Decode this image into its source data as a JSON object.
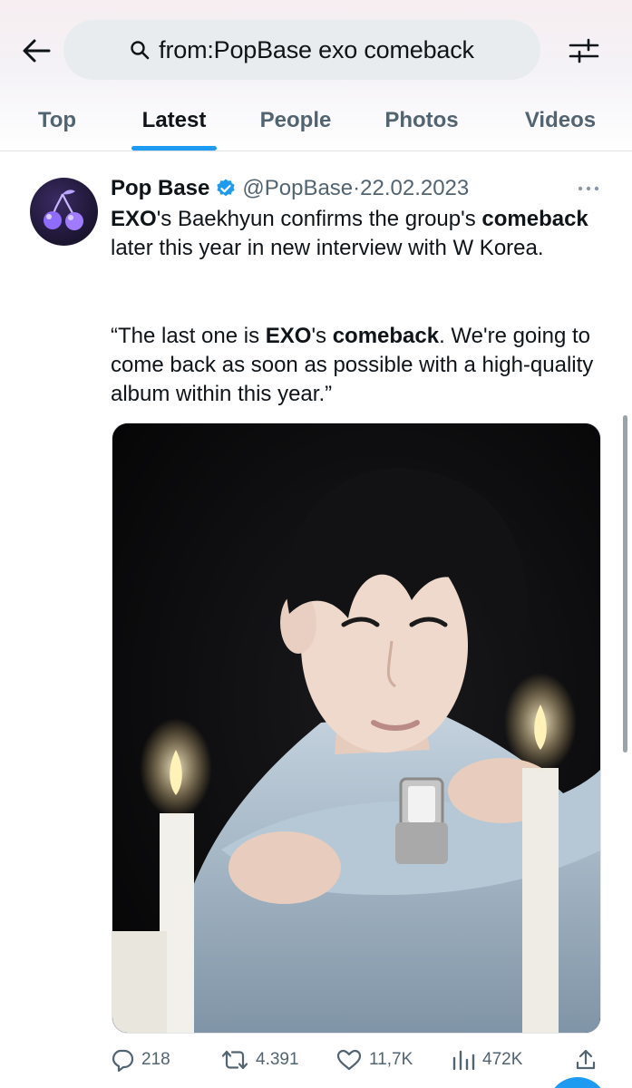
{
  "header": {
    "search_query": "from:PopBase exo comeback",
    "tabs": [
      "Top",
      "Latest",
      "People",
      "Photos",
      "Videos"
    ],
    "active_tab": "Latest"
  },
  "tweet": {
    "display_name": "Pop Base",
    "handle_date": "@PopBase·22.02.2023",
    "para1": [
      {
        "t": "EXO",
        "b": true
      },
      {
        "t": "'s Baekhyun confirms the group's ",
        "b": false
      },
      {
        "t": "comeback",
        "b": true
      },
      {
        "t": " later this year in new interview with W Korea.",
        "b": false
      }
    ],
    "para2": [
      {
        "t": "“The last one is ",
        "b": false
      },
      {
        "t": "EXO",
        "b": true
      },
      {
        "t": "'s ",
        "b": false
      },
      {
        "t": "comeback",
        "b": true
      },
      {
        "t": ". We're going to come back as soon as possible with a high-quality album within this year.”",
        "b": false
      }
    ],
    "stats": {
      "replies": "218",
      "retweets": "4.391",
      "likes": "11,7K",
      "views": "472K"
    }
  },
  "colors": {
    "accent": "#1d9bf0",
    "text_secondary": "#536471",
    "search_bg": "#e8ecef"
  },
  "icons": [
    "back-arrow-icon",
    "search-icon",
    "filter-sliders-icon",
    "verified-badge-icon",
    "more-icon",
    "reply-icon",
    "retweet-icon",
    "like-icon",
    "views-icon",
    "share-icon"
  ]
}
